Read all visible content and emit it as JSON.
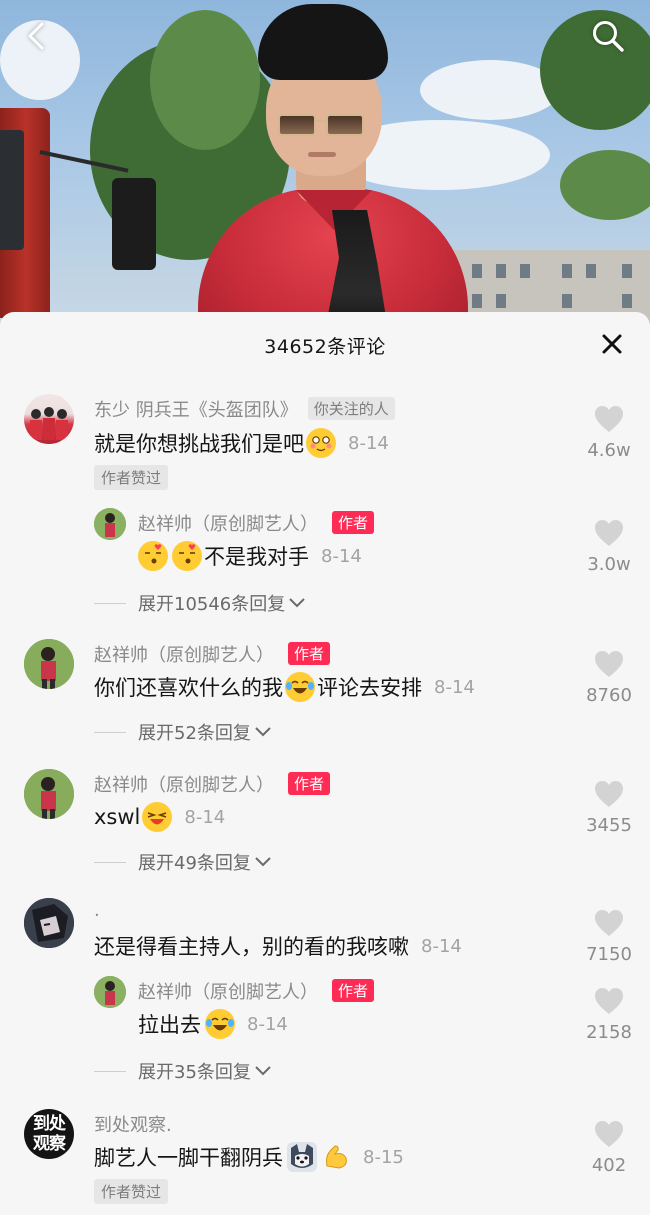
{
  "header": {
    "title": "34652条评论"
  },
  "comments": [
    {
      "name": "东少  阴兵王《头盔团队》",
      "badge": "你关注的人",
      "text": "就是你想挑战我们是吧",
      "date": "8-14",
      "likes": "4.6w",
      "tag": "作者赞过",
      "reply": {
        "name": "赵祥帅（原创脚艺人）",
        "badge": "作者",
        "text": "不是我对手",
        "date": "8-14",
        "likes": "3.0w"
      },
      "expand": "展开10546条回复"
    },
    {
      "name": "赵祥帅（原创脚艺人）",
      "badge": "作者",
      "text_before": "你们还喜欢什么的我",
      "text_after": "评论去安排",
      "date": "8-14",
      "likes": "8760",
      "expand": "展开52条回复"
    },
    {
      "name": "赵祥帅（原创脚艺人）",
      "badge": "作者",
      "text": "xswl",
      "date": "8-14",
      "likes": "3455",
      "expand": "展开49条回复"
    },
    {
      "name": ".",
      "text": "还是得看主持人，别的看的我咳嗽",
      "date": "8-14",
      "likes": "7150",
      "reply": {
        "name": "赵祥帅（原创脚艺人）",
        "badge": "作者",
        "text": "拉出去",
        "date": "8-14",
        "likes": "2158"
      },
      "expand": "展开35条回复"
    },
    {
      "name": "到处观察.",
      "avatar_text": "到处观察",
      "text": "脚艺人一脚干翻阴兵",
      "date": "8-15",
      "likes": "402",
      "tag": "作者赞过"
    }
  ],
  "colors": {
    "accent": "#fe2c55",
    "badge_gray": "#e6e6e6",
    "text_secondary": "#8a8a8a"
  },
  "icons": [
    "back-icon",
    "search-icon",
    "close-icon",
    "heart-icon",
    "chevron-down-icon"
  ]
}
